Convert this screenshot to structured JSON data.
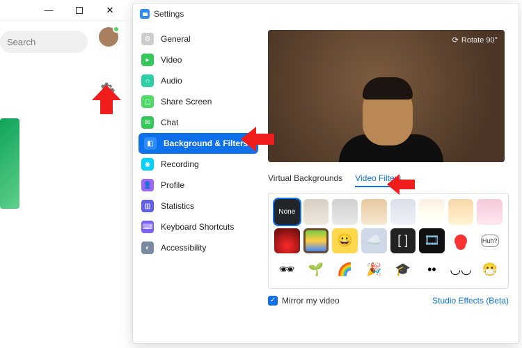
{
  "titlebar": {
    "minimize": "—",
    "maximize": "□",
    "close": "✕"
  },
  "search": {
    "placeholder": "Search"
  },
  "settings": {
    "title": "Settings",
    "items": [
      {
        "label": "General",
        "icon": "general",
        "color": "c-gray"
      },
      {
        "label": "Video",
        "icon": "video",
        "color": "c-green"
      },
      {
        "label": "Audio",
        "icon": "audio",
        "color": "c-teal"
      },
      {
        "label": "Share Screen",
        "icon": "share",
        "color": "c-green2"
      },
      {
        "label": "Chat",
        "icon": "chat",
        "color": "c-green"
      },
      {
        "label": "Background & Filters",
        "icon": "bgfilters",
        "color": "c-blue",
        "active": true
      },
      {
        "label": "Recording",
        "icon": "recording",
        "color": "c-cyan"
      },
      {
        "label": "Profile",
        "icon": "profile",
        "color": "c-purple"
      },
      {
        "label": "Statistics",
        "icon": "statistics",
        "color": "c-indigo"
      },
      {
        "label": "Keyboard Shortcuts",
        "icon": "keyboard",
        "color": "c-violet"
      },
      {
        "label": "Accessibility",
        "icon": "accessibility",
        "color": "c-slate"
      }
    ]
  },
  "preview": {
    "rotate_label": "Rotate 90°"
  },
  "tabs": {
    "virtual_backgrounds": "Virtual Backgrounds",
    "video_filters": "Video Filters",
    "active": "video_filters"
  },
  "filters": {
    "none_label": "None"
  },
  "footer": {
    "mirror_label": "Mirror my video",
    "mirror_checked": true,
    "studio_label": "Studio Effects (Beta)"
  }
}
